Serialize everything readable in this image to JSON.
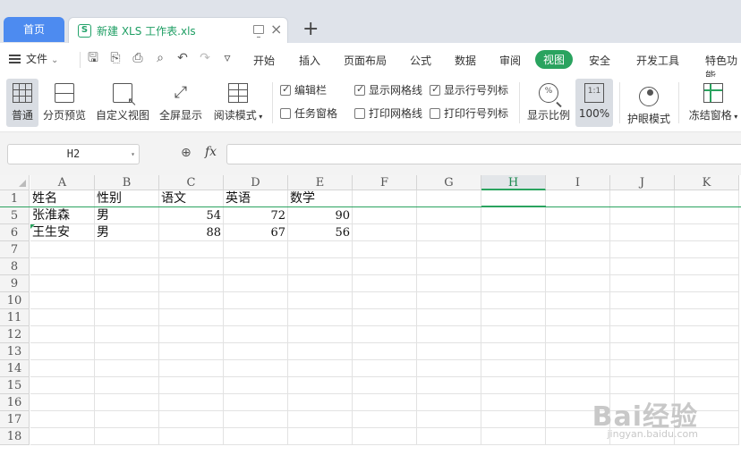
{
  "tabs": {
    "home_label": "首页",
    "file_label": "新建 XLS 工作表.xls",
    "add_label": "+"
  },
  "menu": {
    "file_label": "文件",
    "tabs": [
      "开始",
      "插入",
      "页面布局",
      "公式",
      "数据",
      "审阅",
      "视图",
      "安全",
      "开发工具",
      "特色功能"
    ],
    "active_tab": "视图"
  },
  "ribbon": {
    "buttons": [
      "普通",
      "分页预览",
      "自定义视图",
      "全屏显示",
      "阅读模式"
    ],
    "checkboxes": [
      {
        "label": "编辑栏",
        "checked": true
      },
      {
        "label": "任务窗格",
        "checked": false
      },
      {
        "label": "显示网格线",
        "checked": true
      },
      {
        "label": "打印网格线",
        "checked": false
      },
      {
        "label": "显示行号列标",
        "checked": true
      },
      {
        "label": "打印行号列标",
        "checked": false
      }
    ],
    "zoom_label": "显示比例",
    "zoom_icon_text": "%",
    "zoom_100_label": "100%",
    "zoom_100_icon_text": "1:1",
    "eye_label": "护眼模式",
    "freeze_label": "冻结窗格"
  },
  "formula_bar": {
    "name_box": "H2",
    "fx_label": "fx",
    "formula": ""
  },
  "sheet": {
    "columns": [
      "A",
      "B",
      "C",
      "D",
      "E",
      "F",
      "G",
      "H",
      "I",
      "J",
      "K"
    ],
    "selected_column": "H",
    "rows": [
      {
        "num": "1",
        "cells": [
          "姓名",
          "性别",
          "语文",
          "英语",
          "数学"
        ]
      },
      {
        "num": "5",
        "cells": [
          "张淮森",
          "男",
          "54",
          "72",
          "90"
        ]
      },
      {
        "num": "6",
        "cells": [
          " 王生安",
          "男",
          "88",
          "67",
          "56"
        ]
      },
      {
        "num": "7",
        "cells": []
      },
      {
        "num": "8",
        "cells": []
      },
      {
        "num": "9",
        "cells": []
      },
      {
        "num": "10",
        "cells": []
      },
      {
        "num": "11",
        "cells": []
      },
      {
        "num": "12",
        "cells": []
      },
      {
        "num": "13",
        "cells": []
      },
      {
        "num": "14",
        "cells": []
      },
      {
        "num": "15",
        "cells": []
      },
      {
        "num": "16",
        "cells": []
      },
      {
        "num": "17",
        "cells": []
      },
      {
        "num": "18",
        "cells": []
      }
    ]
  },
  "watermark": {
    "main": "Bai经验",
    "sub": "jingyan.baidu.com"
  },
  "colors": {
    "accent": "#2aa35f",
    "home_tab": "#4d8bf0"
  }
}
